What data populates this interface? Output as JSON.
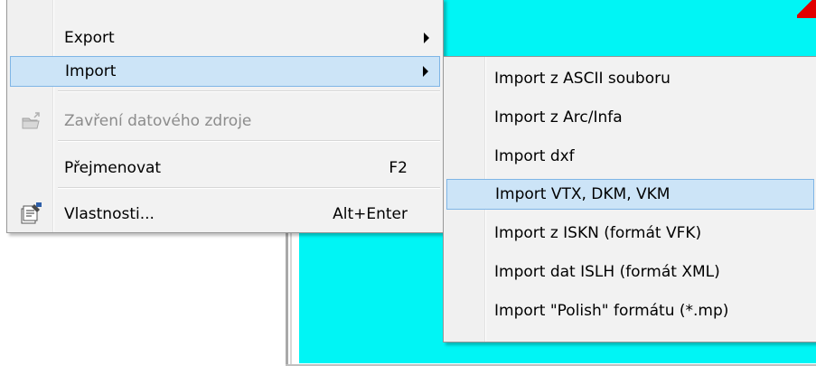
{
  "main_menu": {
    "items": [
      {
        "label": "Export",
        "has_submenu": true
      },
      {
        "label": "Import",
        "has_submenu": true,
        "highlighted": true
      },
      {
        "label": "Zavření datového zdroje",
        "disabled": true,
        "icon": "folder-close-icon"
      },
      {
        "label": "Přejmenovat",
        "shortcut": "F2"
      },
      {
        "label": "Vlastnosti...",
        "shortcut": "Alt+Enter",
        "icon": "properties-icon"
      }
    ]
  },
  "submenu": {
    "items": [
      {
        "label": "Import z ASCII souboru"
      },
      {
        "label": "Import z Arc/Infa"
      },
      {
        "label": "Import dxf"
      },
      {
        "label": "Import VTX, DKM, VKM",
        "highlighted": true
      },
      {
        "label": "Import z ISKN (formát VFK)"
      },
      {
        "label": "Import dat ISLH (formát XML)"
      },
      {
        "label": "Import \"Polish\" formátu (*.mp)"
      }
    ]
  },
  "colors": {
    "canvas_background": "#00f5f5",
    "highlight": "#cce4f7",
    "highlight_border": "#7fb5e6",
    "menu_background": "#f2f2f2"
  }
}
